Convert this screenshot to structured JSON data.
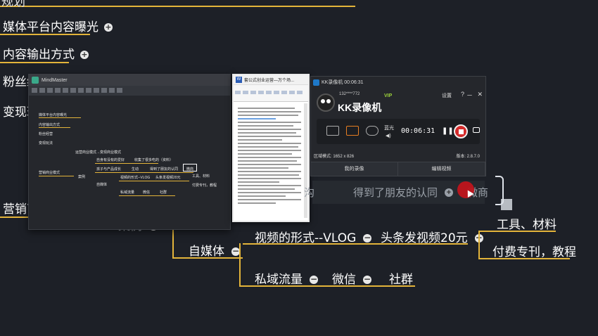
{
  "mindmap": {
    "top_cut": "规划",
    "left_items": [
      {
        "label": "媒体平台内容曝光"
      },
      {
        "label": "内容输出方式"
      },
      {
        "label": "粉丝经营"
      },
      {
        "label": "变现玩法"
      }
    ],
    "marketing": "营销商业模式",
    "case_label": "案例",
    "self_media": "自媒体",
    "video_form": "视频的形式--VLOG",
    "toutiao_video": "头条发视频20元",
    "tools": "工具、材料",
    "paid": "付费专刊，教程",
    "private_traffic": "私域流量",
    "wechat": "微信",
    "community": "社群",
    "friend_recognition": "得到了朋友的认同",
    "weishang": "微商",
    "faded_left": "沟"
  },
  "mindmaster": {
    "app_title": "MindMaster",
    "nodes": [
      "媒体平台内容曝光",
      "内容输出方式",
      "粉丝经营",
      "变现玩法",
      "营销商业模式",
      "运营商业模式→变现商业模式",
      "自身有没有的爱好",
      "收集了很多吃的（资料）",
      "孩子与产品成长",
      "生动",
      "得到了朋友的认同",
      "微商",
      "案例",
      "自媒体",
      "视频的形式--VLOG",
      "头条发视频20元",
      "工具、材料",
      "付费专刊，教程",
      "私域流量",
      "微信",
      "社群"
    ]
  },
  "document": {
    "title": "套公式创业运营—万个场..."
  },
  "kk": {
    "title": "KK录像机 00:06:31",
    "user": "132****772",
    "vip": "VIP",
    "brand": "KK录像机",
    "settings": "设置",
    "help": "?",
    "minimize": "－",
    "close": "✕",
    "mode_label": "蓝光",
    "timer": "00:06:31",
    "resolution": "区域模式: 1652 x 826",
    "version": "版本: 2.8.7.0",
    "tab_recordings": "我的录像",
    "tab_edit": "编辑视频"
  },
  "colors": {
    "background": "#1d2027",
    "branch": "#e3b43a",
    "record": "#d42b2b",
    "vip": "#9cd33a"
  }
}
